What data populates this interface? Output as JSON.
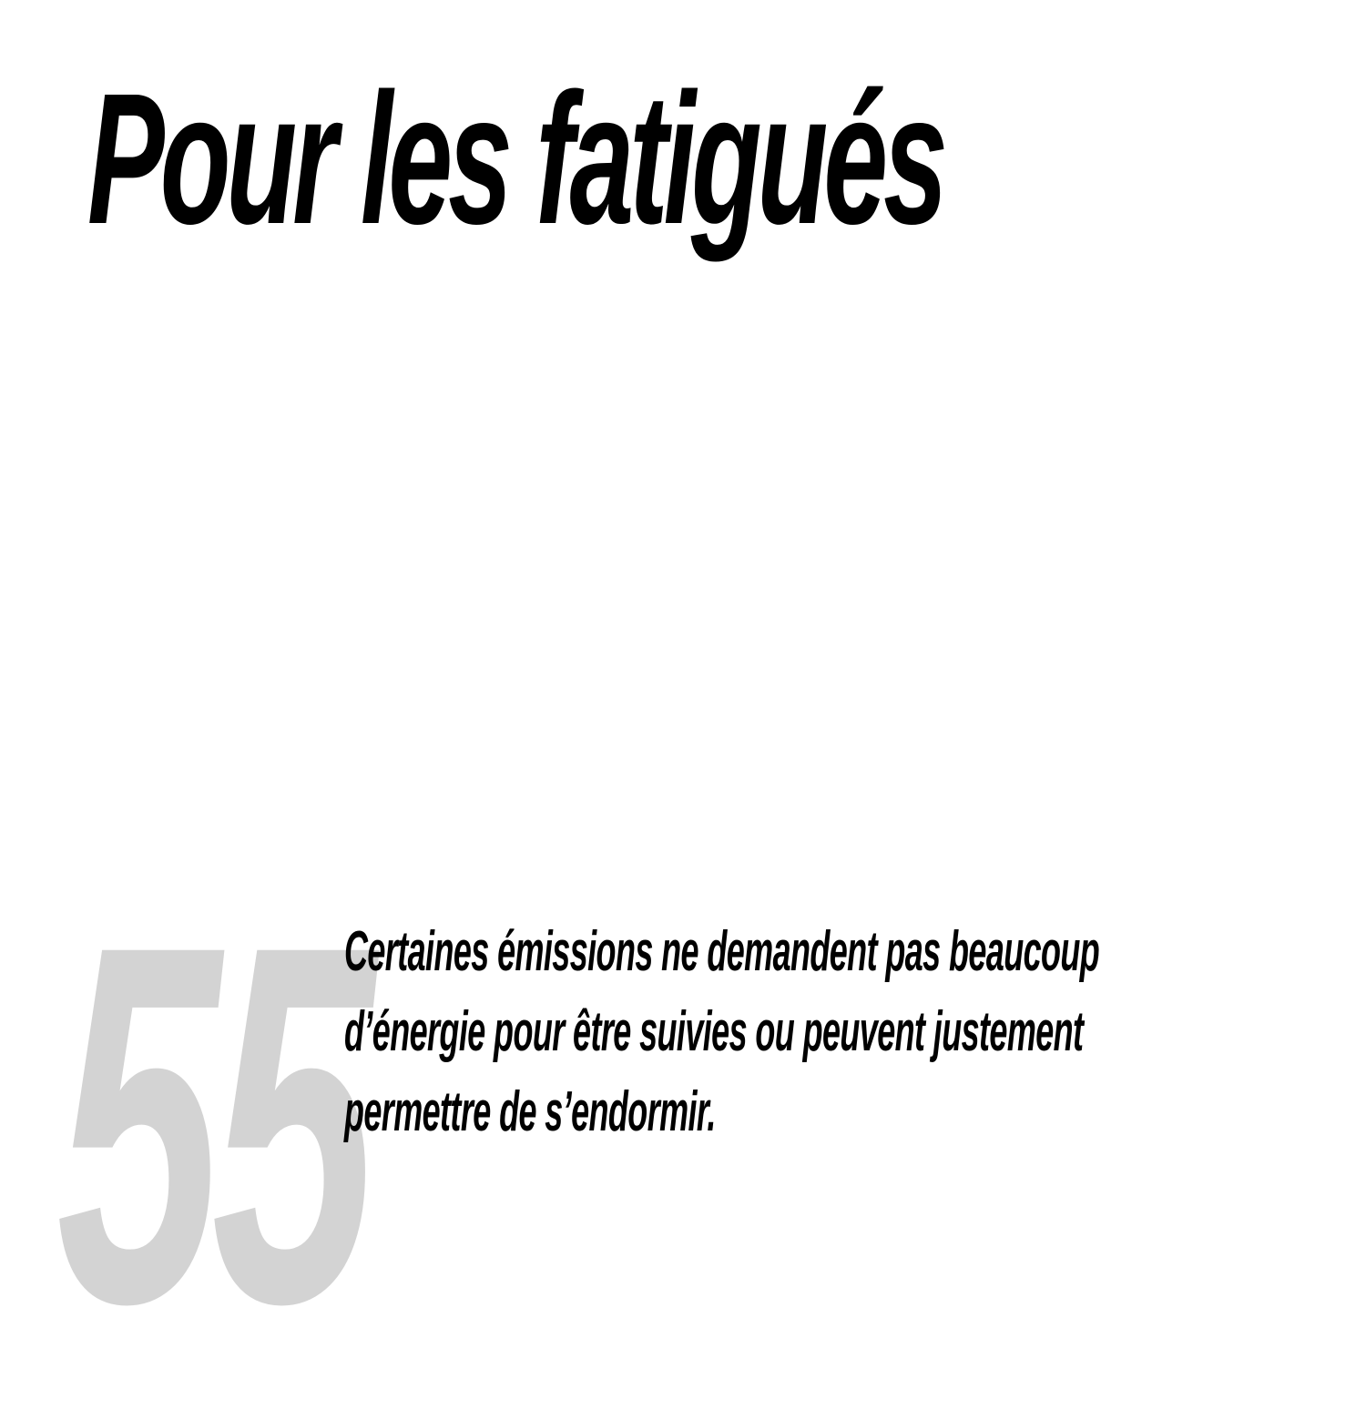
{
  "title": "Pour les fatigués",
  "number": "55",
  "body_lines": [
    "Certaines émissions ne demandent pas beaucoup",
    "d’énergie pour être suivies ou peuvent justement",
    "permettre de s’endormir."
  ],
  "colors": {
    "background": "#ffffff",
    "text": "#000000",
    "number": "#d3d3d3"
  }
}
